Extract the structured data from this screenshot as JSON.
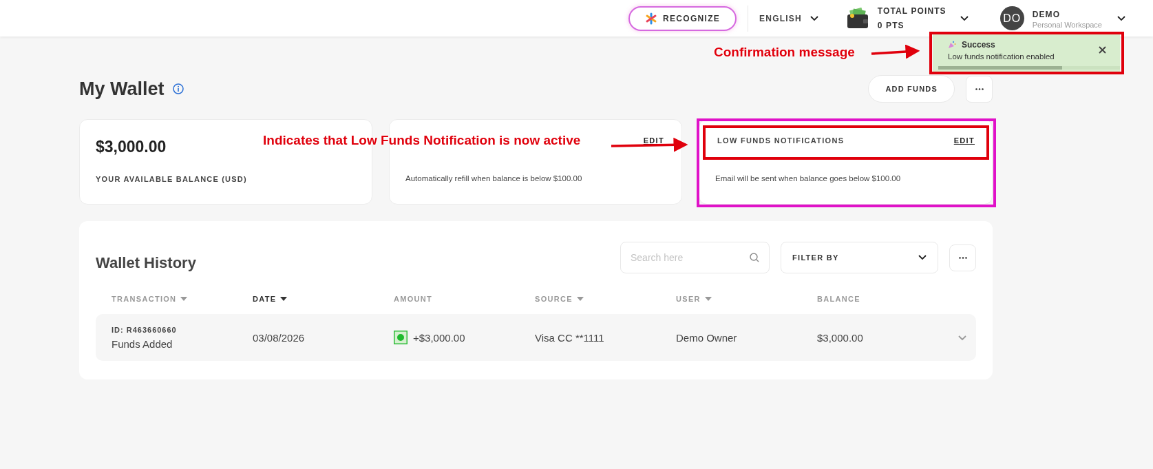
{
  "header": {
    "recognize": "RECOGNIZE",
    "language": "ENGLISH",
    "points": {
      "label": "TOTAL POINTS",
      "value": "0 PTS"
    },
    "user": {
      "initials": "DO",
      "name": "DEMO",
      "workspace": "Personal Workspace"
    }
  },
  "toast": {
    "title": "Success",
    "message": "Low funds notification enabled",
    "level": 0.68
  },
  "page": {
    "title": "My Wallet",
    "add_funds": "ADD FUNDS"
  },
  "cards": [
    {
      "kind": "balance",
      "amount": "$3,000.00",
      "caption": "YOUR AVAILABLE BALANCE (USD)"
    },
    {
      "kind": "setting",
      "edit": "EDIT",
      "description": "Automatically refill when balance is below $100.00"
    },
    {
      "kind": "setting",
      "title": "LOW FUNDS NOTIFICATIONS",
      "edit": "EDIT",
      "description": "Email will be sent when balance goes below $100.00"
    }
  ],
  "history": {
    "title": "Wallet History",
    "search": {
      "placeholder": "Search here"
    },
    "filter": "FILTER BY",
    "columns": [
      {
        "label": "TRANSACTION",
        "sortable": true,
        "active": false
      },
      {
        "label": "DATE",
        "sortable": true,
        "active": true
      },
      {
        "label": "AMOUNT",
        "sortable": false,
        "active": false
      },
      {
        "label": "SOURCE",
        "sortable": true,
        "active": false
      },
      {
        "label": "USER",
        "sortable": true,
        "active": false
      },
      {
        "label": "BALANCE",
        "sortable": false,
        "active": false
      }
    ],
    "rows": [
      {
        "id": "ID: R463660660",
        "type": "Funds Added",
        "date": "03/08/2026",
        "amount": "+$3,000.00",
        "source": "Visa CC **1111",
        "user": "Demo Owner",
        "balance": "$3,000.00"
      }
    ]
  },
  "annotations": [
    {
      "kind": "callout",
      "text": "Confirmation message"
    },
    {
      "kind": "callout",
      "text": "Indicates that Low Funds Notification is now active"
    }
  ]
}
